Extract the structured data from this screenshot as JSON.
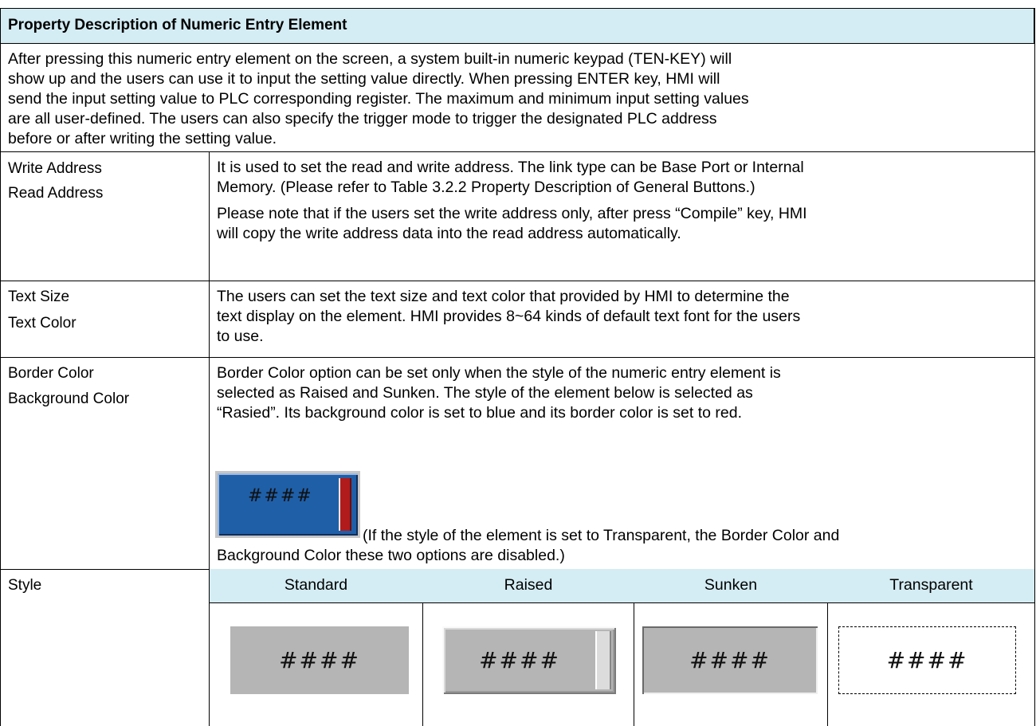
{
  "title": "Property Description of Numeric Entry Element",
  "description_lines": [
    "After pressing this numeric entry element on the screen, a system built-in numeric keypad (TEN-KEY) will",
    "show up and the users can use it to input the setting value directly. When pressing ENTER key, HMI will",
    "send the input setting value to PLC corresponding register. The maximum and minimum input setting values",
    "are all user-defined. The users can also specify the trigger mode to trigger the designated PLC address",
    "before or after writing the setting value."
  ],
  "rows": {
    "address": {
      "labels": [
        "Write Address",
        "Read Address"
      ],
      "lines": [
        "It is used to set the read and write address. The link type can be Base Port or Internal",
        "Memory. (Please refer to Table 3.2.2 Property Description of General Buttons.)",
        "Please note that if the users set the write address only, after press “Compile” key, HMI",
        "will copy the write address data into the read address automatically."
      ]
    },
    "text": {
      "labels": [
        "Text Size",
        "Text Color"
      ],
      "lines": [
        "The users can set the text size and text color that provided by HMI to determine the",
        "text display on the element. HMI provides 8~64 kinds of default text font for the users",
        "to use."
      ]
    },
    "color": {
      "labels": [
        "Border Color",
        "Background Color"
      ],
      "lines": [
        "Border Color option can be set only when the style of the numeric entry element is",
        "selected as Raised and Sunken. The style of the element below is selected as",
        "“Rasied”. Its background color is set to blue and its border color is set to red."
      ],
      "example_text": "####",
      "example_background_color": "#1f5fa8",
      "example_border_color": "#b11b1b",
      "note_line1": "(If the style of the element is set to Transparent, the Border Color and",
      "note_line2": "Background Color these two options are disabled.)"
    },
    "style": {
      "label": "Style",
      "columns": [
        "Standard",
        "Raised",
        "Sunken",
        "Transparent"
      ],
      "sample_text": "####"
    }
  },
  "colors": {
    "header_background": "#d4ecf3",
    "sample_gray": "#b5b5b5"
  }
}
